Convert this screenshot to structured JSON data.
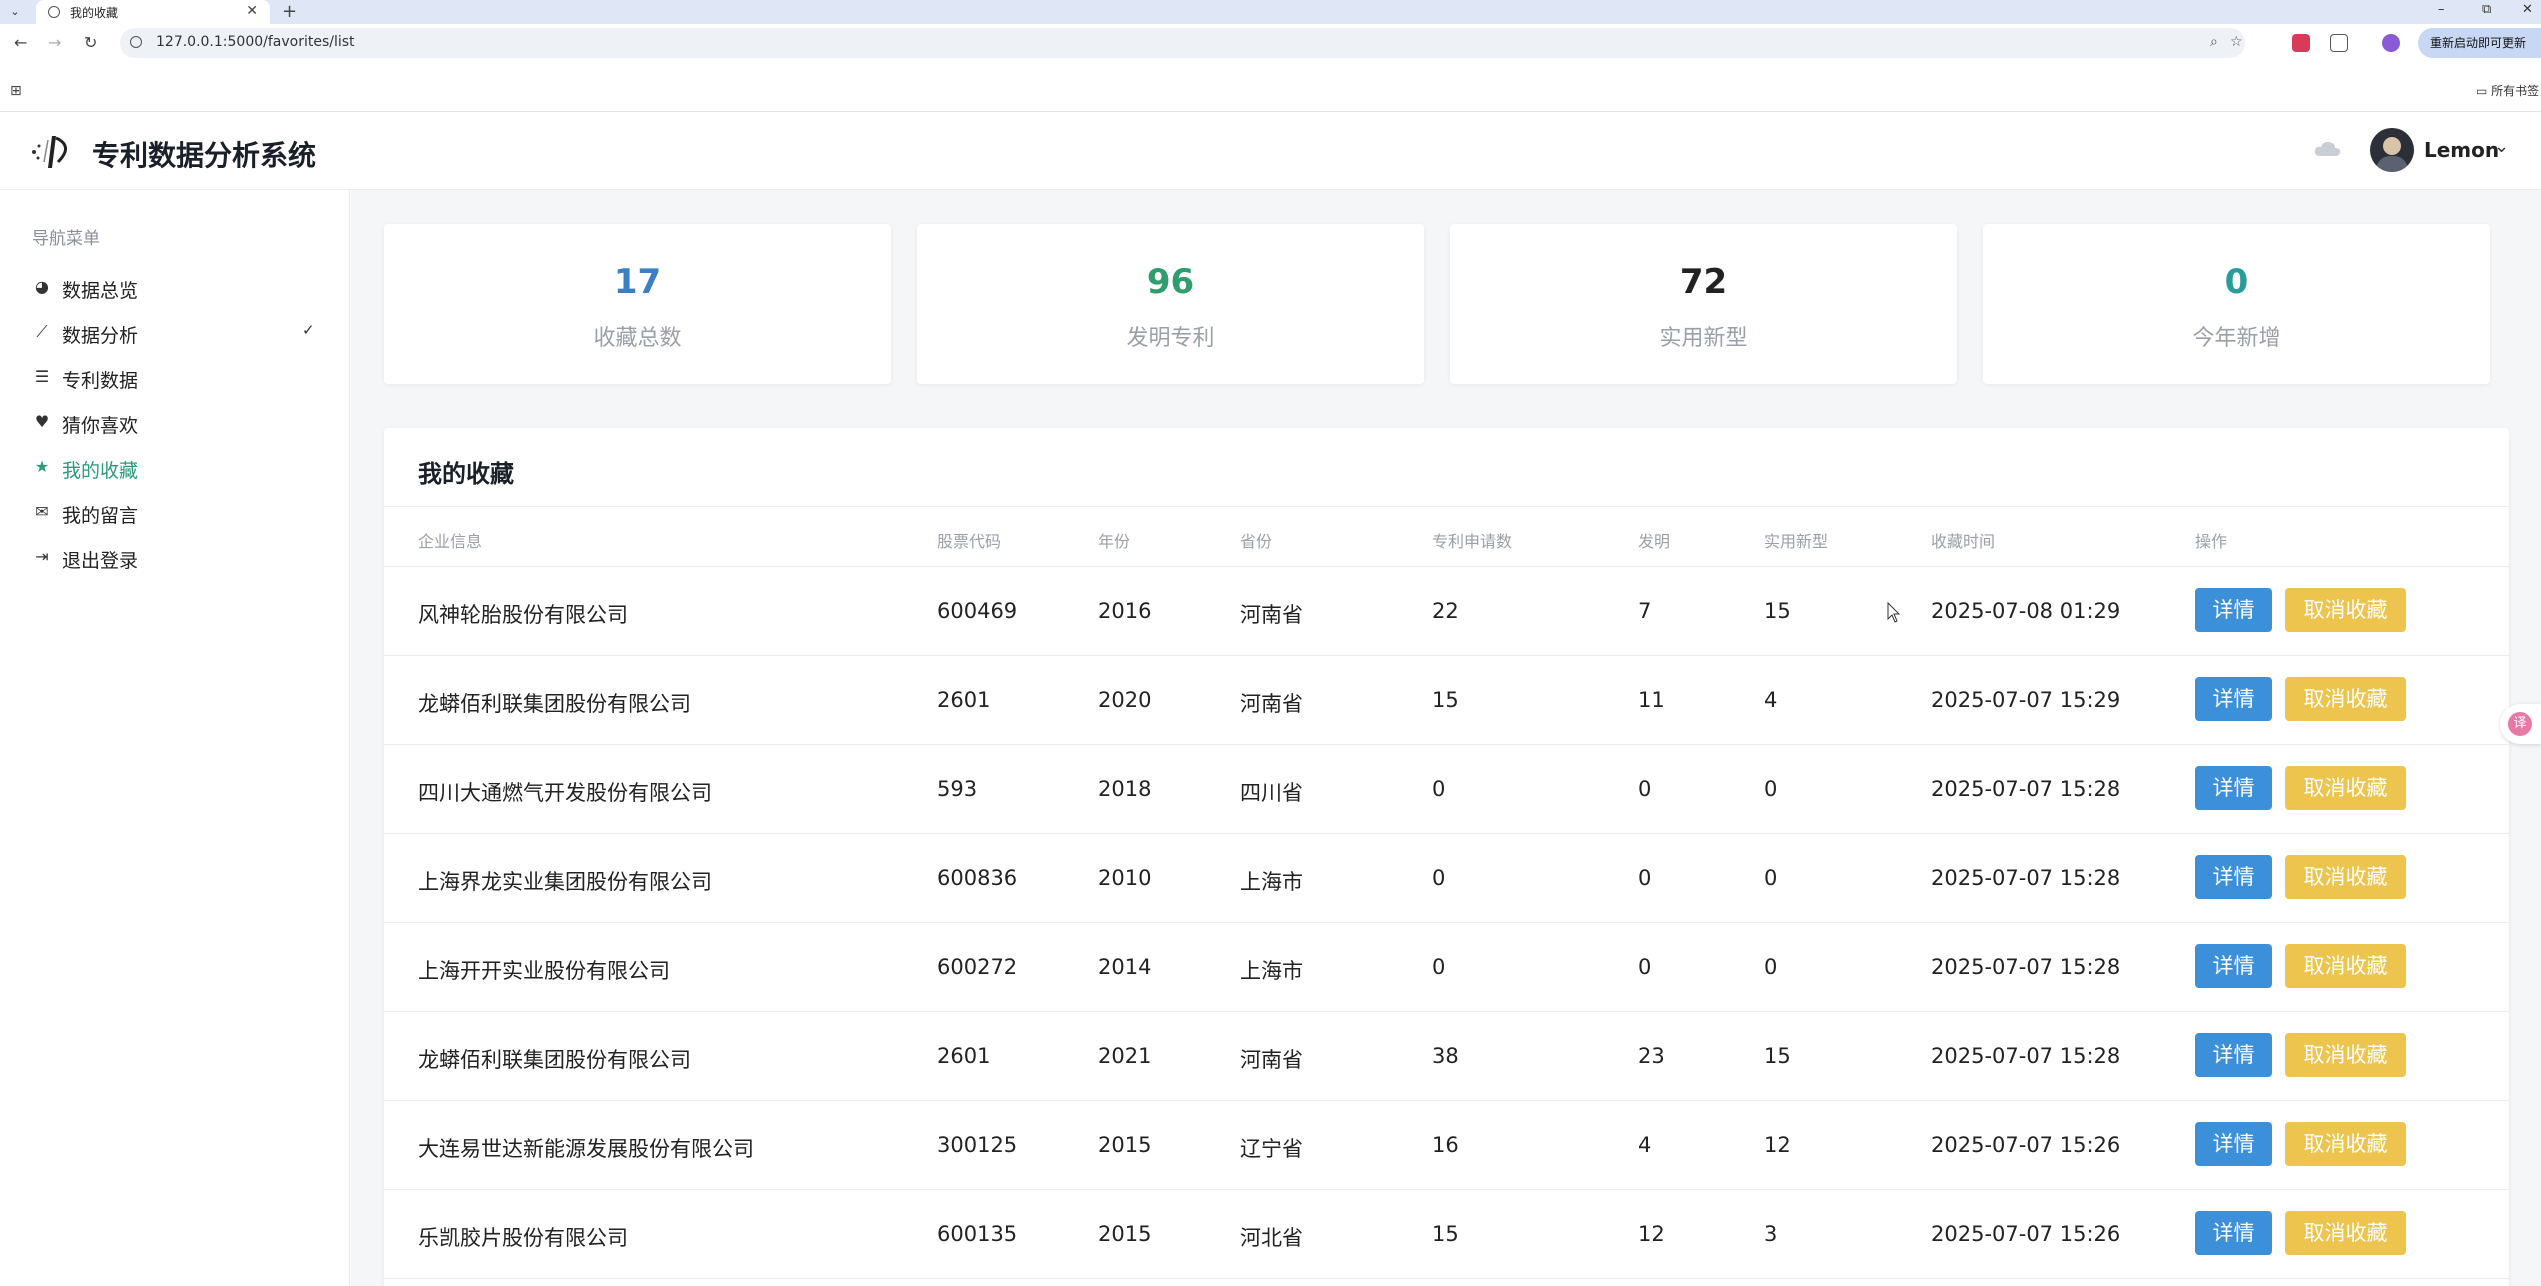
{
  "browser": {
    "tab_title": "我的收藏",
    "tab_close": "✕",
    "new_tab": "+",
    "url": "127.0.0.1:5000/favorites/list",
    "update_button": "重新启动即可更新",
    "bookmarks_folder": "所有书签",
    "window_controls": {
      "minimize": "–",
      "maximize": "⧉",
      "close": "✕"
    }
  },
  "app": {
    "title": "专利数据分析系统",
    "user": {
      "name": "Lemon",
      "caret": "⌄"
    }
  },
  "sidebar": {
    "heading": "导航菜单",
    "items": [
      {
        "label": "数据总览",
        "icon": "pie-chart-icon",
        "glyph": "◕"
      },
      {
        "label": "数据分析",
        "icon": "line-chart-icon",
        "glyph": "⟋",
        "caret": "✓"
      },
      {
        "label": "专利数据",
        "icon": "database-icon",
        "glyph": "☰"
      },
      {
        "label": "猜你喜欢",
        "icon": "heart-icon",
        "glyph": "♥"
      },
      {
        "label": "我的收藏",
        "icon": "star-icon",
        "glyph": "★",
        "active": true
      },
      {
        "label": "我的留言",
        "icon": "comments-icon",
        "glyph": "✉"
      },
      {
        "label": "退出登录",
        "icon": "logout-icon",
        "glyph": "⇥"
      }
    ]
  },
  "stats": [
    {
      "value": "17",
      "label": "收藏总数",
      "color": "#3b7fc4"
    },
    {
      "value": "96",
      "label": "发明专利",
      "color": "#2e9e6e"
    },
    {
      "value": "72",
      "label": "实用新型",
      "color": "#222222"
    },
    {
      "value": "0",
      "label": "今年新增",
      "color": "#2a9d9a"
    }
  ],
  "favorites": {
    "title": "我的收藏",
    "columns": [
      "企业信息",
      "股票代码",
      "年份",
      "省份",
      "专利申请数",
      "发明",
      "实用新型",
      "收藏时间",
      "操作"
    ],
    "detail_label": "详情",
    "cancel_label": "取消收藏",
    "rows": [
      {
        "company": "风神轮胎股份有限公司",
        "code": "600469",
        "year": "2016",
        "province": "河南省",
        "applications": "22",
        "invention": "7",
        "utility": "15",
        "time": "2025-07-08 01:29"
      },
      {
        "company": "龙蟒佰利联集团股份有限公司",
        "code": "2601",
        "year": "2020",
        "province": "河南省",
        "applications": "15",
        "invention": "11",
        "utility": "4",
        "time": "2025-07-07 15:29"
      },
      {
        "company": "四川大通燃气开发股份有限公司",
        "code": "593",
        "year": "2018",
        "province": "四川省",
        "applications": "0",
        "invention": "0",
        "utility": "0",
        "time": "2025-07-07 15:28"
      },
      {
        "company": "上海界龙实业集团股份有限公司",
        "code": "600836",
        "year": "2010",
        "province": "上海市",
        "applications": "0",
        "invention": "0",
        "utility": "0",
        "time": "2025-07-07 15:28"
      },
      {
        "company": "上海开开实业股份有限公司",
        "code": "600272",
        "year": "2014",
        "province": "上海市",
        "applications": "0",
        "invention": "0",
        "utility": "0",
        "time": "2025-07-07 15:28"
      },
      {
        "company": "龙蟒佰利联集团股份有限公司",
        "code": "2601",
        "year": "2021",
        "province": "河南省",
        "applications": "38",
        "invention": "23",
        "utility": "15",
        "time": "2025-07-07 15:28"
      },
      {
        "company": "大连易世达新能源发展股份有限公司",
        "code": "300125",
        "year": "2015",
        "province": "辽宁省",
        "applications": "16",
        "invention": "4",
        "utility": "12",
        "time": "2025-07-07 15:26"
      },
      {
        "company": "乐凯胶片股份有限公司",
        "code": "600135",
        "year": "2015",
        "province": "河北省",
        "applications": "15",
        "invention": "12",
        "utility": "3",
        "time": "2025-07-07 15:26"
      }
    ]
  }
}
